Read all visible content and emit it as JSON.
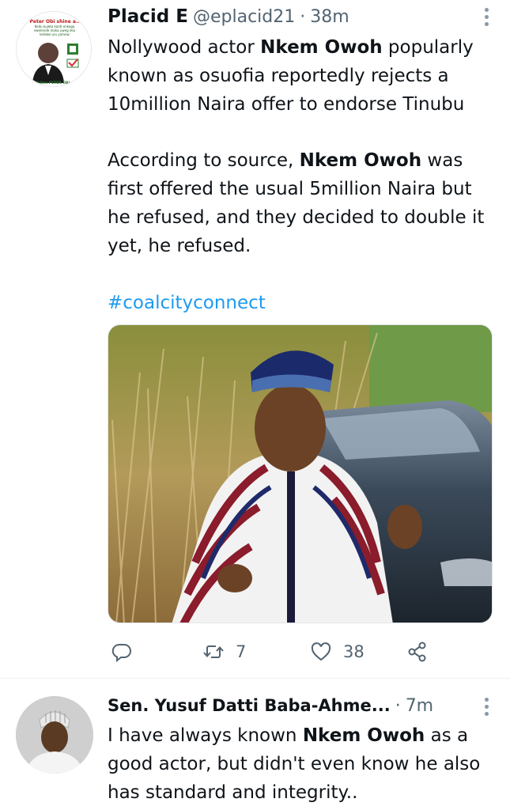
{
  "tweet": {
    "author_name": "Placid E",
    "author_handle": "@eplacid21",
    "separator": "·",
    "time": "38m",
    "avatar_text": {
      "line1": "Peter Obi shine a..",
      "line2": "Kedu kujeta kanti enkoga",
      "line3": "ewelende maka uweg eka",
      "line4": "kelebel ulu yamew",
      "line5": "Valien PETER OBI..."
    },
    "p1": {
      "a": "Nollywood actor ",
      "b": "Nkem Owoh",
      "c": " popularly known as osuofia reportedly rejects a 10million Naira offer to endorse Tinubu"
    },
    "p2": {
      "a": "According to source, ",
      "b": "Nkem Owoh",
      "c": " was first offered the usual 5million Naira  but he refused, and they decided to double it yet, he refused."
    },
    "hashtag": "#coalcityconnect",
    "actions": {
      "retweets": "7",
      "likes": "38"
    }
  },
  "reply": {
    "author_name": "Sen. Yusuf Datti Baba-Ahme...",
    "separator": "·",
    "time": "7m",
    "text": {
      "a": "I have always known ",
      "b": "Nkem Owoh",
      "c": " as a good actor, but didn't even know he also has standard and integrity.."
    }
  },
  "colors": {
    "link": "#1d9bf0",
    "secondary": "#536471",
    "text": "#0f1419"
  },
  "icons": [
    "more-vertical-icon",
    "reply-icon",
    "retweet-icon",
    "like-icon",
    "share-icon"
  ]
}
